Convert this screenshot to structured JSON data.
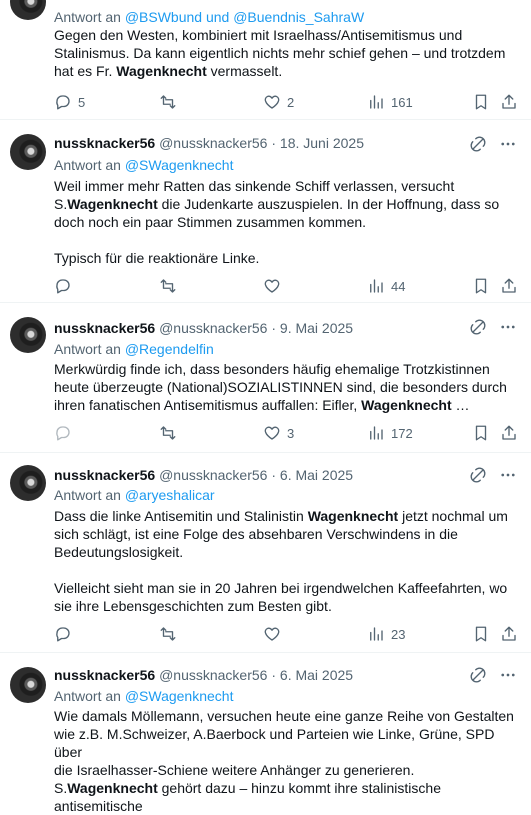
{
  "tweets": [
    {
      "reply_prefix": "Antwort an",
      "reply_to": "@BSWbund und @Buendnis_SahraW",
      "lines": [
        "Gegen den Westen, kombiniert mit Israelhass/Antisemitismus und",
        "Stalinismus. Da kann eigentlich nichts mehr schief gehen – und trotzdem",
        "hat es Fr. "
      ],
      "bold_word": "Wagenknecht",
      "tail": " vermasselt.",
      "replies": "5",
      "retweets": "",
      "likes": "2",
      "views": "161"
    },
    {
      "name": "nussknacker56",
      "handle": "@nussknacker56",
      "sep": "·",
      "date": "18. Juni 2025",
      "reply_prefix": "Antwort an",
      "reply_to": "@SWagenknecht",
      "p1_a": "Weil immer mehr Ratten das sinkende Schiff verlassen, versucht",
      "p1_b": "S.",
      "p1_bold": "Wagenknecht",
      "p1_c": " die Judenkarte auszuspielen. In der Hoffnung, dass so",
      "p1_d": "doch noch ein paar Stimmen zusammen kommen.",
      "p2": "Typisch für die reaktionäre Linke.",
      "replies": "",
      "retweets": "",
      "likes": "",
      "views": "44"
    },
    {
      "name": "nussknacker56",
      "handle": "@nussknacker56",
      "sep": "·",
      "date": "9. Mai 2025",
      "reply_prefix": "Antwort an",
      "reply_to": "@Regendelfin",
      "l1": "Merkwürdig finde ich, dass besonders häufig ehemalige Trotzkistinnen",
      "l2": "heute überzeugte (National)SOZIALISTINNEN sind, die besonders durch",
      "l3": "ihren fanatischen Antisemitismus auffallen: Eifler, ",
      "bold_word": "Wagenknecht",
      "ellipsis": " …",
      "replies": "",
      "retweets": "",
      "likes": "3",
      "views": "172"
    },
    {
      "name": "nussknacker56",
      "handle": "@nussknacker56",
      "sep": "·",
      "date": "6. Mai 2025",
      "reply_prefix": "Antwort an",
      "reply_to": "@aryeshalicar",
      "l1_a": "Dass die linke Antisemitin und Stalinistin ",
      "l1_bold": "Wagenknecht",
      "l1_b": " jetzt nochmal um",
      "l2": "sich schlägt, ist eine Folge des absehbaren Verschwindens in die",
      "l3": "Bedeutungslosigkeit.",
      "p2_a": "Vielleicht sieht man sie in 20 Jahren bei irgendwelchen Kaffeefahrten, wo",
      "p2_b": "sie ihre Lebensgeschichten zum Besten gibt.",
      "replies": "",
      "retweets": "",
      "likes": "",
      "views": "23"
    },
    {
      "name": "nussknacker56",
      "handle": "@nussknacker56",
      "sep": "·",
      "date": "6. Mai 2025",
      "reply_prefix": "Antwort an",
      "reply_to": "@SWagenknecht",
      "l1": "Wie damals Möllemann, versuchen heute eine ganze Reihe von Gestalten",
      "l2": "wie z.B. M.Schweizer, A.Baerbock und Parteien wie Linke, Grüne, SPD über",
      "l3": "die Israelhasser-Schiene weitere Anhänger zu generieren.",
      "l4_a": "S.",
      "l4_bold": "Wagenknecht",
      "l4_b": " gehört dazu – hinzu kommt ihre stalinistische",
      "l5": "antisemitische"
    }
  ],
  "colors": {
    "accent": "#1d9bf0",
    "muted": "#536471",
    "text": "#0f1419"
  },
  "icons": [
    "reply-icon",
    "retweet-icon",
    "like-icon",
    "views-icon",
    "bookmark-icon",
    "share-icon",
    "grok-icon",
    "more-icon"
  ]
}
